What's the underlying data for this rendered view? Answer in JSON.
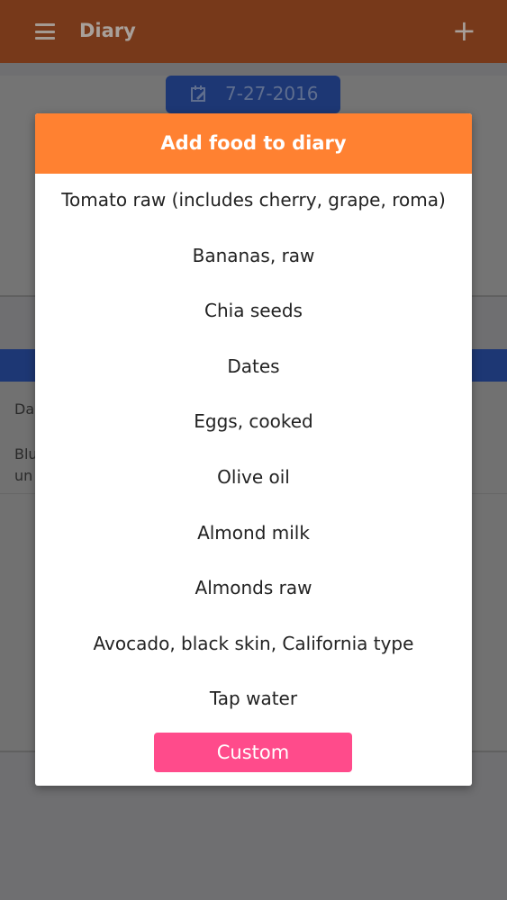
{
  "appbar": {
    "title": "Diary",
    "add_symbol": "+",
    "menu_icon": "hamburger-menu-icon",
    "add_icon": "plus-icon"
  },
  "date_button": {
    "label": "7-27-2016",
    "icon": "calendar-edit-icon"
  },
  "background": {
    "row1_text": "Da",
    "row2_line1": "Blu",
    "row2_line2": "un"
  },
  "dialog": {
    "title": "Add food to diary",
    "items": [
      "Tomato raw (includes cherry, grape, roma)",
      "Bananas, raw",
      "Chia seeds",
      "Dates",
      "Eggs, cooked",
      "Olive oil",
      "Almond milk",
      "Almonds raw",
      "Avocado, black skin, California type",
      "Tap water"
    ],
    "custom_label": "Custom"
  },
  "colors": {
    "appbar": "#77391a",
    "dialog_header": "#ff8131",
    "custom_button": "#ff4b8b",
    "date_button": "#1d3774",
    "overlay": "#6f6f71"
  }
}
